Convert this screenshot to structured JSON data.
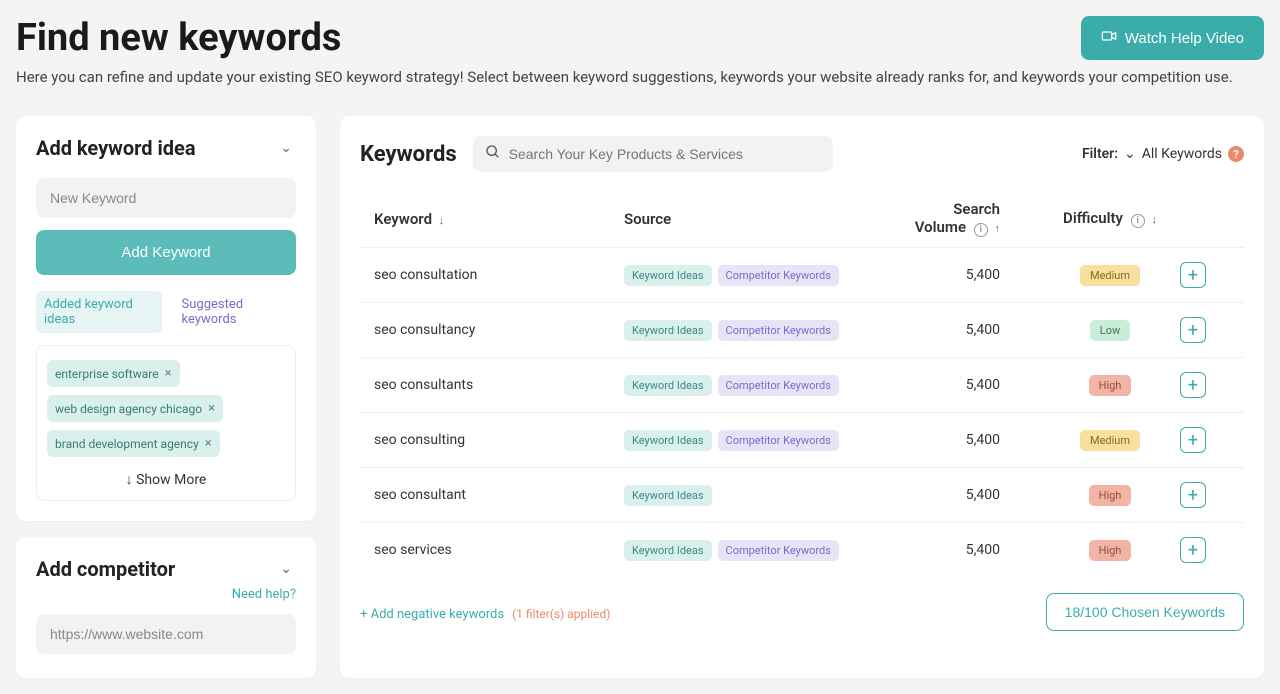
{
  "page": {
    "title": "Find new keywords",
    "description": "Here you can refine and update your existing SEO keyword strategy! Select between keyword suggestions, keywords your website already ranks for, and keywords your competition use.",
    "help_video": "Watch Help Video"
  },
  "add_keyword": {
    "title": "Add keyword idea",
    "input_placeholder": "New Keyword",
    "button": "Add Keyword",
    "tabs": {
      "added": "Added keyword ideas",
      "suggested": "Suggested keywords"
    },
    "chips": [
      "enterprise software",
      "web design agency chicago",
      "brand development agency"
    ],
    "show_more": "Show More"
  },
  "add_competitor": {
    "title": "Add competitor",
    "need_help": "Need help?",
    "input_value": "https://www.website.com"
  },
  "main": {
    "title": "Keywords",
    "search_placeholder": "Search Your Key Products & Services",
    "filter_label": "Filter:",
    "filter_value": "All Keywords",
    "columns": {
      "keyword": "Keyword",
      "source": "Source",
      "volume": "Search Volume",
      "difficulty": "Difficulty"
    },
    "badges": {
      "ideas": "Keyword Ideas",
      "competitor": "Competitor Keywords"
    },
    "rows": [
      {
        "keyword": "seo consultation",
        "sources": [
          "ideas",
          "competitor"
        ],
        "volume": "5,400",
        "difficulty": "Medium"
      },
      {
        "keyword": "seo consultancy",
        "sources": [
          "ideas",
          "competitor"
        ],
        "volume": "5,400",
        "difficulty": "Low"
      },
      {
        "keyword": "seo consultants",
        "sources": [
          "ideas",
          "competitor"
        ],
        "volume": "5,400",
        "difficulty": "High"
      },
      {
        "keyword": "seo consulting",
        "sources": [
          "ideas",
          "competitor"
        ],
        "volume": "5,400",
        "difficulty": "Medium"
      },
      {
        "keyword": "seo consultant",
        "sources": [
          "ideas"
        ],
        "volume": "5,400",
        "difficulty": "High"
      },
      {
        "keyword": "seo services",
        "sources": [
          "ideas",
          "competitor"
        ],
        "volume": "5,400",
        "difficulty": "High"
      }
    ],
    "negative_link": "+ Add negative keywords",
    "negative_filter": "(1 filter(s) applied)",
    "chosen": "18/100 Chosen Keywords"
  }
}
